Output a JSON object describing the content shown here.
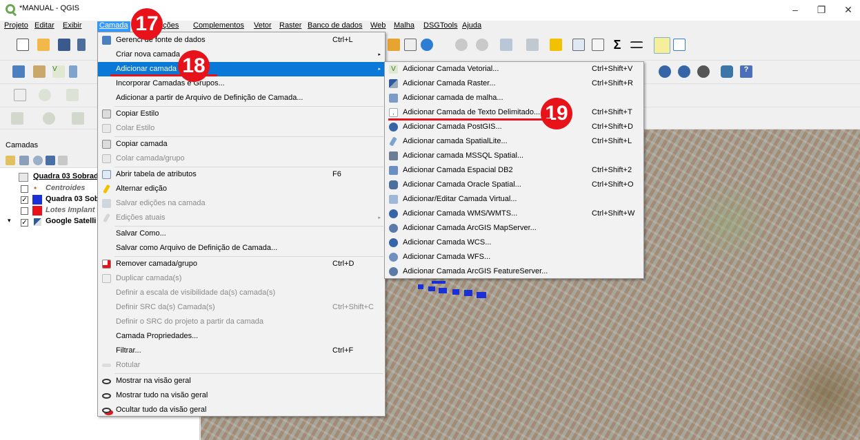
{
  "window": {
    "title": "*MANUAL - QGIS",
    "minimize": "–",
    "maximize": "❐",
    "close": "✕"
  },
  "menubar": {
    "items": [
      "Projeto",
      "Editar",
      "Exibir",
      "Camada",
      "Configurações",
      "Complementos",
      "Vetor",
      "Raster",
      "Banco de dados",
      "Web",
      "Malha",
      "DSGTools",
      "Ajuda"
    ],
    "visible_configuracoes": "ações"
  },
  "layers_panel": {
    "title": "Camadas",
    "layers": [
      {
        "name": "Quadra 03 Sobrad",
        "checked": "",
        "icon": "table-icon"
      },
      {
        "name": "Centroides",
        "checked": "",
        "icon": "point-icon"
      },
      {
        "name": "Quadra 03 Sob",
        "checked": "✓",
        "icon": "polygon-icon"
      },
      {
        "name": "Lotes Implant",
        "checked": "",
        "icon": "polygon-icon"
      },
      {
        "name": "Google Satelli",
        "checked": "✓",
        "icon": "raster-icon"
      }
    ],
    "expander": "▾"
  },
  "camada_menu": {
    "items": [
      {
        "label": "Gerenciador de fonte de dados",
        "visible_label": "Gerenci   de fonte de dados",
        "shortcut": "Ctrl+L",
        "icon": "datasource-icon"
      },
      {
        "label": "Criar nova camada",
        "submenu": "▸"
      },
      {
        "label": "Adicionar camada",
        "submenu": "▸",
        "highlighted": true
      },
      {
        "label": "Incorporar Camadas e Grupos..."
      },
      {
        "label": "Adicionar a partir de Arquivo de Definição de Camada..."
      },
      {
        "label": "Copiar Estilo",
        "icon": "copy-icon"
      },
      {
        "label": "Colar Estilo",
        "disabled": true,
        "icon": "paste-icon"
      },
      {
        "label": "Copiar camada",
        "icon": "copy-icon"
      },
      {
        "label": "Colar camada/grupo",
        "disabled": true,
        "icon": "paste-icon"
      },
      {
        "label": "Abrir tabela de atributos",
        "shortcut": "F6",
        "icon": "table-icon"
      },
      {
        "label": "Alternar edição",
        "icon": "pencil-icon"
      },
      {
        "label": "Salvar edições na camada",
        "disabled": true,
        "icon": "save-edits-icon"
      },
      {
        "label": "Edições atuais",
        "disabled": true,
        "submenu": "▸",
        "icon": "edits-icon"
      },
      {
        "label": "Salvar Como..."
      },
      {
        "label": "Salvar como Arquivo de Definição de Camada..."
      },
      {
        "label": "Remover camada/grupo",
        "shortcut": "Ctrl+D",
        "icon": "remove-layer-icon"
      },
      {
        "label": "Duplicar camada(s)",
        "disabled": true,
        "icon": "duplicate-icon"
      },
      {
        "label": "Definir a escala de visibilidade da(s) camada(s)",
        "disabled": true
      },
      {
        "label": "Definir SRC da(s) Camada(s)",
        "shortcut": "Ctrl+Shift+C",
        "disabled": true
      },
      {
        "label": "Definir o SRC do projeto a partir da camada",
        "disabled": true
      },
      {
        "label": "Camada Propriedades..."
      },
      {
        "label": "Filtrar...",
        "shortcut": "Ctrl+F"
      },
      {
        "label": "Rotular",
        "disabled": true,
        "icon": "label-icon"
      },
      {
        "label": "Mostrar na visão geral",
        "icon": "overview-show-icon"
      },
      {
        "label": "Mostrar tudo na visão geral",
        "icon": "overview-all-icon"
      },
      {
        "label": "Ocultar tudo da visão geral",
        "icon": "overview-hide-icon"
      }
    ]
  },
  "adicionar_submenu": {
    "items": [
      {
        "label": "Adicionar Camada Vetorial...",
        "shortcut": "Ctrl+Shift+V",
        "icon": "vector-layer-icon"
      },
      {
        "label": "Adicionar Camada Raster...",
        "shortcut": "Ctrl+Shift+R",
        "icon": "raster-layer-icon"
      },
      {
        "label": "Adicionar camada de malha...",
        "icon": "mesh-layer-icon"
      },
      {
        "label": "Adicionar Camada de Texto Delimitado...",
        "shortcut": "Ctrl+Shift+T",
        "icon": "delimited-text-icon"
      },
      {
        "label": "Adicionar Camada PostGIS...",
        "shortcut": "Ctrl+Shift+D",
        "icon": "postgis-icon"
      },
      {
        "label": "Adicionar camada SpatialLite...",
        "shortcut": "Ctrl+Shift+L",
        "icon": "spatialite-icon"
      },
      {
        "label": "Adicionar camada MSSQL Spatial...",
        "icon": "mssql-icon"
      },
      {
        "label": "Adicionar Camada Espacial DB2",
        "shortcut": "Ctrl+Shift+2",
        "icon": "db2-icon"
      },
      {
        "label": "Adicionar Camada Oracle Spatial...",
        "shortcut": "Ctrl+Shift+O",
        "icon": "oracle-icon"
      },
      {
        "label": "Adicionar/Editar Camada Virtual...",
        "icon": "virtual-layer-icon"
      },
      {
        "label": "Adicionar Camada WMS/WMTS...",
        "shortcut": "Ctrl+Shift+W",
        "icon": "wms-icon"
      },
      {
        "label": "Adicionar Camada ArcGIS MapServer...",
        "icon": "arcgis-mapserver-icon"
      },
      {
        "label": "Adicionar Camada WCS...",
        "icon": "wcs-icon"
      },
      {
        "label": "Adicionar Camada WFS...",
        "icon": "wfs-icon"
      },
      {
        "label": "Adicionar Camada ArcGIS FeatureServer...",
        "icon": "arcgis-featureserver-icon"
      }
    ]
  },
  "callouts": [
    "17",
    "18",
    "19"
  ],
  "colors": {
    "callout": "#e8131a",
    "highlight": "#0a78d7",
    "menubar_active": "#3399ff"
  }
}
